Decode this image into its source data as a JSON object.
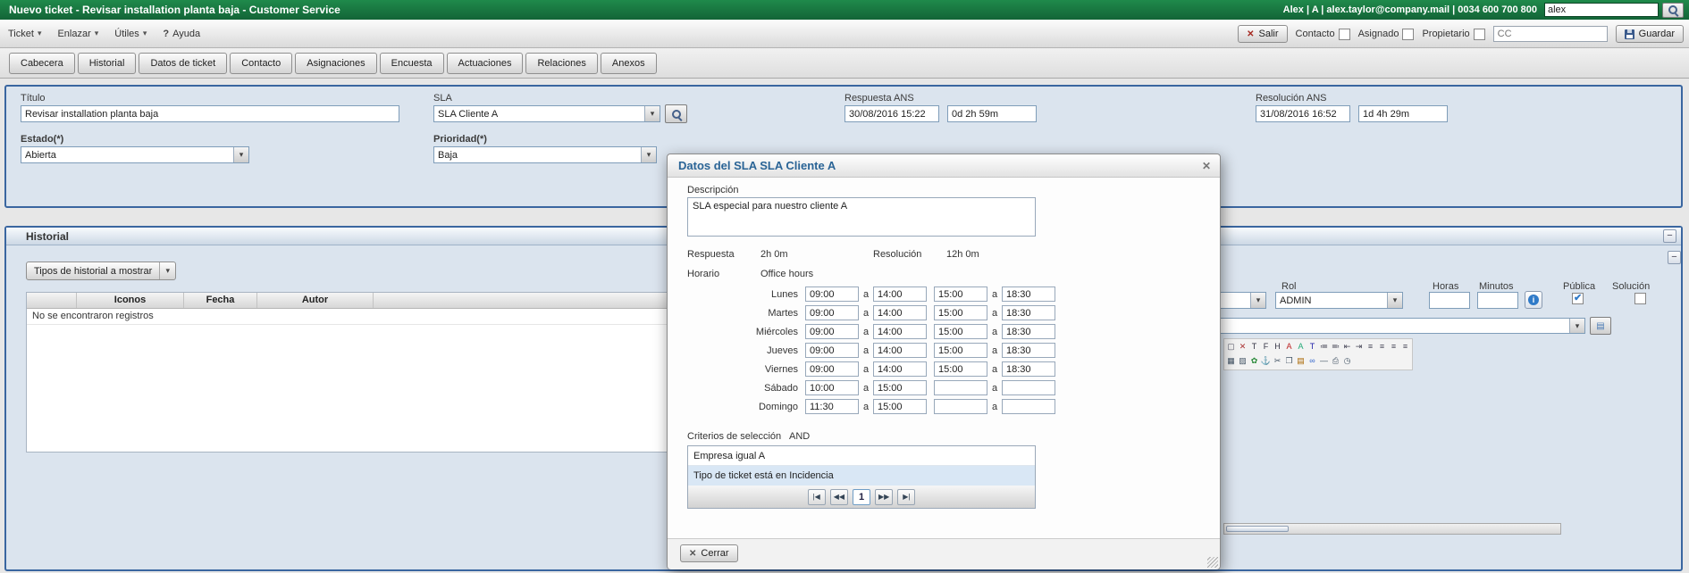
{
  "icons": {
    "caret": "▾",
    "collapse": "−",
    "close": "✕",
    "help": "?"
  },
  "topbar": {
    "title": "Nuevo ticket -  Revisar installation planta baja -  Customer Service",
    "user_info": "Alex | A | alex.taylor@company.mail | 0034 600 700 800",
    "search_value": "alex"
  },
  "menubar": {
    "items": [
      {
        "label": "Ticket"
      },
      {
        "label": "Enlazar"
      },
      {
        "label": "Útiles"
      },
      {
        "label": "Ayuda"
      }
    ],
    "salir_label": "Salir",
    "contacto_label": "Contacto",
    "asignado_label": "Asignado",
    "propietario_label": "Propietario",
    "cc_placeholder": "CC",
    "guardar_label": "Guardar"
  },
  "tabs": [
    {
      "label": "Cabecera"
    },
    {
      "label": "Historial"
    },
    {
      "label": "Datos de ticket"
    },
    {
      "label": "Contacto"
    },
    {
      "label": "Asignaciones"
    },
    {
      "label": "Encuesta"
    },
    {
      "label": "Actuaciones"
    },
    {
      "label": "Relaciones"
    },
    {
      "label": "Anexos"
    }
  ],
  "cabecera": {
    "titulo_label": "Título",
    "titulo_value": "Revisar installation planta baja",
    "sla_label": "SLA",
    "sla_value": "SLA Cliente A",
    "respuesta_ans_label": "Respuesta ANS",
    "respuesta_ans_fecha": "30/08/2016 15:22",
    "respuesta_ans_restante": "0d 2h 59m",
    "resolucion_ans_label": "Resolución ANS",
    "resolucion_ans_fecha": "31/08/2016 16:52",
    "resolucion_ans_restante": "1d 4h 29m",
    "estado_label": "Estado(*)",
    "estado_value": "Abierta",
    "prioridad_label": "Prioridad(*)",
    "prioridad_value": "Baja"
  },
  "historial": {
    "title": "Historial",
    "filtro_label": "Tipos de historial a mostrar",
    "columns": [
      {
        "label": ""
      },
      {
        "label": "Iconos"
      },
      {
        "label": "Fecha"
      },
      {
        "label": "Autor"
      }
    ],
    "empty_message": "No se encontraron registros"
  },
  "actuacion": {
    "rol_label": "Rol",
    "rol_value": "ADMIN",
    "horas_label": "Horas",
    "minutos_label": "Minutos",
    "publica_label": "Pública",
    "solucion_label": "Solución",
    "toolbar_row1": [
      {
        "name": "maximize-icon",
        "glyph": "▢",
        "color": "#556"
      },
      {
        "name": "remove-format-icon",
        "glyph": "✕",
        "color": "#a33"
      },
      {
        "name": "font-size-icon",
        "glyph": "T",
        "color": "#334"
      },
      {
        "name": "font-family-icon",
        "glyph": "F",
        "color": "#334"
      },
      {
        "name": "heading-icon",
        "glyph": "H",
        "color": "#334"
      },
      {
        "name": "text-color-icon",
        "glyph": "A",
        "color": "#b22"
      },
      {
        "name": "highlight-color-icon",
        "glyph": "A",
        "color": "#2a7"
      },
      {
        "name": "styles-icon",
        "glyph": "T",
        "color": "#22a"
      },
      {
        "name": "bullet-list-icon",
        "glyph": "≔",
        "color": "#445"
      },
      {
        "name": "numbered-list-icon",
        "glyph": "≕",
        "color": "#445"
      },
      {
        "name": "outdent-icon",
        "glyph": "⇤",
        "color": "#445"
      },
      {
        "name": "indent-icon",
        "glyph": "⇥",
        "color": "#445"
      },
      {
        "name": "align-left-icon",
        "glyph": "≡",
        "color": "#445"
      },
      {
        "name": "align-center-icon",
        "glyph": "≡",
        "color": "#445"
      },
      {
        "name": "align-right-icon",
        "glyph": "≡",
        "color": "#445"
      },
      {
        "name": "align-justify-icon",
        "glyph": "≡",
        "color": "#445"
      }
    ],
    "toolbar_row2": [
      {
        "name": "table-icon",
        "glyph": "▦",
        "color": "#456"
      },
      {
        "name": "image-icon",
        "glyph": "▨",
        "color": "#456"
      },
      {
        "name": "flower-icon",
        "glyph": "✿",
        "color": "#2a8a3a"
      },
      {
        "name": "anchor-icon",
        "glyph": "⚓",
        "color": "#456"
      },
      {
        "name": "cut-icon",
        "glyph": "✂",
        "color": "#456"
      },
      {
        "name": "copy-icon",
        "glyph": "❐",
        "color": "#456"
      },
      {
        "name": "paste-icon",
        "glyph": "▤",
        "color": "#a60"
      },
      {
        "name": "link-icon",
        "glyph": "∞",
        "color": "#36c"
      },
      {
        "name": "rule-icon",
        "glyph": "―",
        "color": "#456"
      },
      {
        "name": "print-icon",
        "glyph": "⎙",
        "color": "#456"
      },
      {
        "name": "clock-icon",
        "glyph": "◷",
        "color": "#456"
      }
    ]
  },
  "modal": {
    "title": "Datos del SLA SLA Cliente A",
    "descripcion_label": "Descripción",
    "descripcion_value": "SLA especial para nuestro cliente A",
    "respuesta_label": "Respuesta",
    "respuesta_value": "2h 0m",
    "resolucion_label": "Resolución",
    "resolucion_value": "12h 0m",
    "horario_label": "Horario",
    "horario_value": "Office hours",
    "conector": "a",
    "schedule": [
      {
        "day": "Lunes",
        "m1": "09:00",
        "m2": "14:00",
        "t1": "15:00",
        "t2": "18:30"
      },
      {
        "day": "Martes",
        "m1": "09:00",
        "m2": "14:00",
        "t1": "15:00",
        "t2": "18:30"
      },
      {
        "day": "Miércoles",
        "m1": "09:00",
        "m2": "14:00",
        "t1": "15:00",
        "t2": "18:30"
      },
      {
        "day": "Jueves",
        "m1": "09:00",
        "m2": "14:00",
        "t1": "15:00",
        "t2": "18:30"
      },
      {
        "day": "Viernes",
        "m1": "09:00",
        "m2": "14:00",
        "t1": "15:00",
        "t2": "18:30"
      },
      {
        "day": "Sábado",
        "m1": "10:00",
        "m2": "15:00",
        "t1": "",
        "t2": ""
      },
      {
        "day": "Domingo",
        "m1": "11:30",
        "m2": "15:00",
        "t1": "",
        "t2": ""
      }
    ],
    "criterios_label": "Criterios de selección",
    "criterios_operador": "AND",
    "criterios": [
      {
        "text": "Empresa igual A"
      },
      {
        "text": "Tipo de ticket está en Incidencia"
      }
    ],
    "pager": {
      "first": "|◀",
      "prev": "◀◀",
      "page": "1",
      "next": "▶▶",
      "last": "▶|"
    },
    "cerrar_label": "Cerrar"
  }
}
